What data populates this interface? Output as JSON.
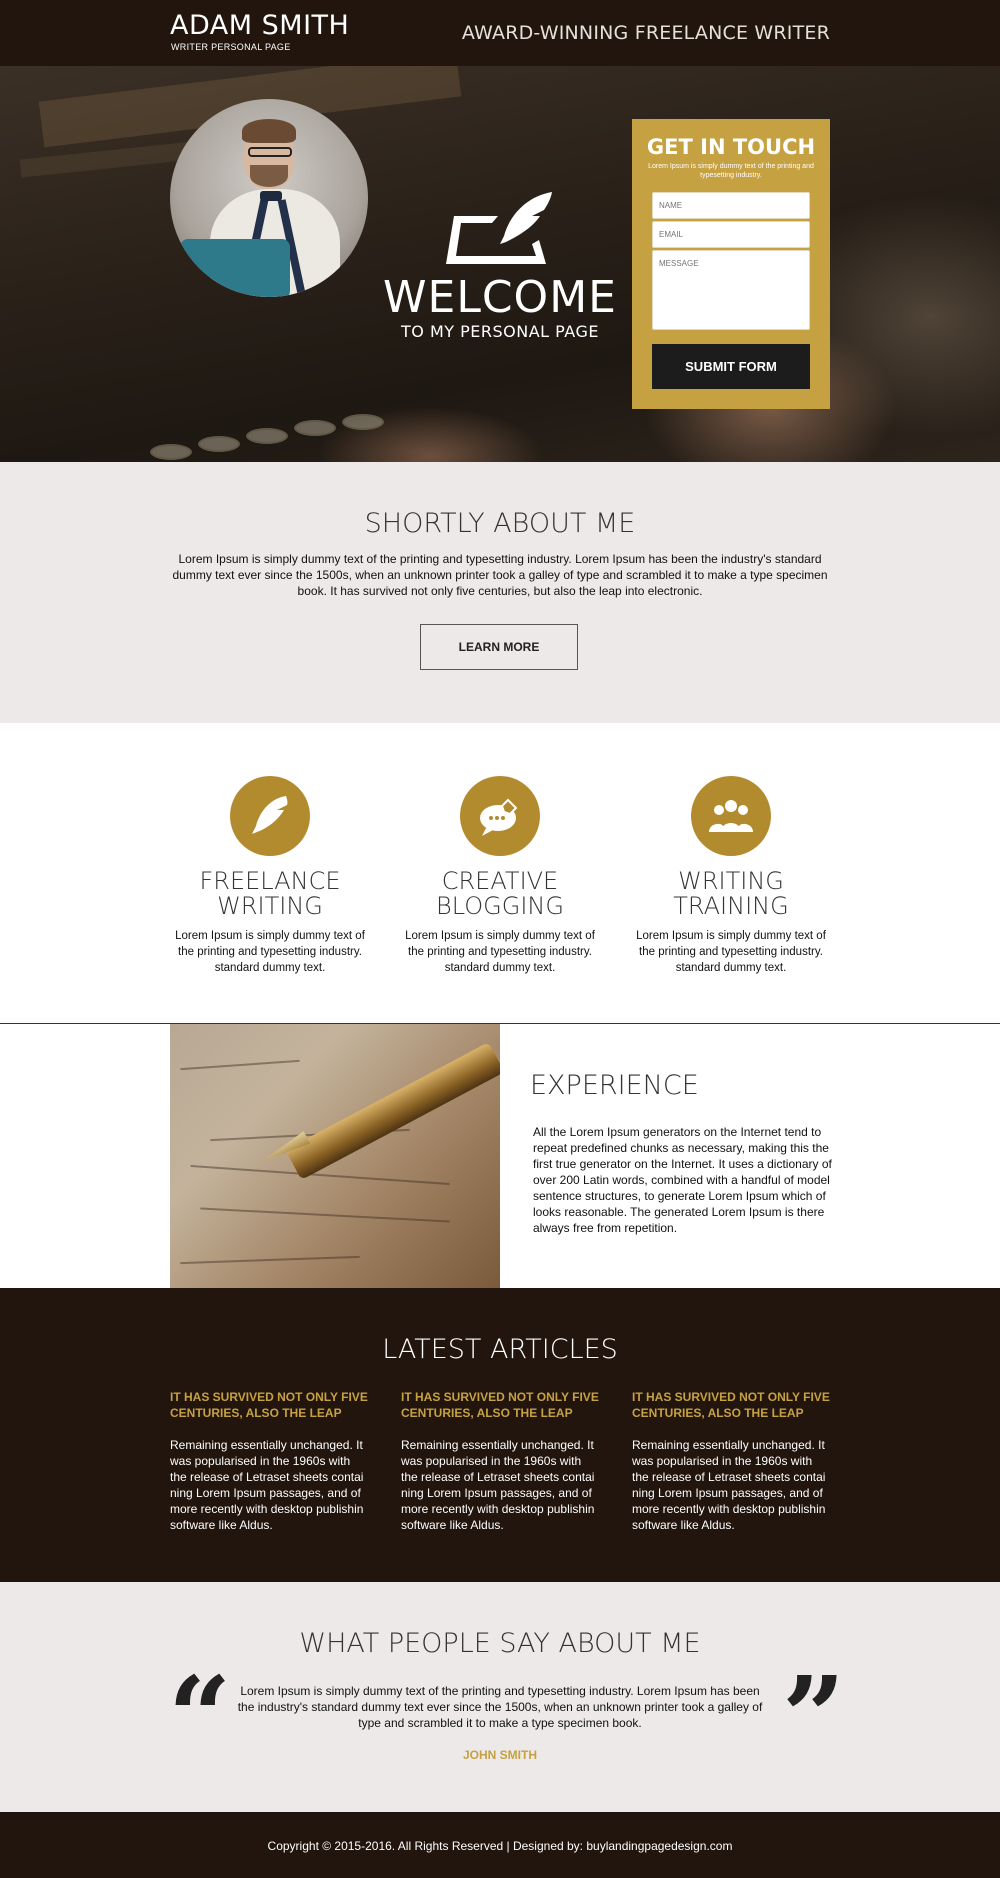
{
  "header": {
    "name": "ADAM SMITH",
    "subtitle": "WRITER PERSONAL PAGE",
    "tagline": "AWARD-WINNING FREELANCE WRITER"
  },
  "hero": {
    "welcome_title": "WELCOME",
    "welcome_subtitle": "TO MY PERSONAL PAGE"
  },
  "contact_form": {
    "title": "GET IN TOUCH",
    "description": "Lorem Ipsum is simply dummy text of the printing and typesetting industry.",
    "name_placeholder": "NAME",
    "email_placeholder": "EMAIL",
    "message_placeholder": "MESSAGE",
    "submit_label": "SUBMIT FORM"
  },
  "about": {
    "title": "SHORTLY ABOUT ME",
    "text": "Lorem Ipsum is simply dummy text of the printing and typesetting industry. Lorem Ipsum has been the industry's standard dummy text ever since the 1500s, when an unknown printer took a galley of type and scrambled it to make a type specimen book. It has survived not only five centuries, but also the leap into electronic.",
    "button_label": "LEARN MORE"
  },
  "services": [
    {
      "title": "FREELANCE WRITING",
      "icon": "feather-icon",
      "text": "Lorem Ipsum is simply dummy text of the printing and typesetting industry. standard dummy text."
    },
    {
      "title": "CREATIVE BLOGGING",
      "icon": "chat-bubble-icon",
      "text": "Lorem Ipsum is simply dummy text of the printing and typesetting industry. standard dummy text."
    },
    {
      "title": "WRITING TRAINING",
      "icon": "group-icon",
      "text": "Lorem Ipsum is simply dummy text of the printing and typesetting industry. standard dummy text."
    }
  ],
  "experience": {
    "title": "EXPERIENCE",
    "text": "All the Lorem Ipsum generators on the Internet tend to repeat predefined chunks as necessary, making this the first true generator on the Internet. It uses a dictionary of over 200 Latin words, combined with a handful of model sentence structures, to generate Lorem Ipsum which of looks reasonable. The generated Lorem Ipsum is there always free from repetition."
  },
  "articles": {
    "title": "LATEST ARTICLES",
    "items": [
      {
        "heading": "IT HAS SURVIVED NOT ONLY FIVE CENTURIES, ALSO THE LEAP",
        "body": "Remaining essentially unchanged. It was popularised in the 1960s with the release of Letraset sheets contai ning Lorem Ipsum passages, and of more recently with desktop publishin software like Aldus."
      },
      {
        "heading": "IT HAS SURVIVED NOT ONLY FIVE CENTURIES, ALSO THE LEAP",
        "body": "Remaining essentially unchanged. It was popularised in the 1960s with the release of Letraset sheets contai ning Lorem Ipsum passages, and of more recently with desktop publishin software like Aldus."
      },
      {
        "heading": "IT HAS SURVIVED NOT ONLY FIVE CENTURIES, ALSO THE LEAP",
        "body": "Remaining essentially unchanged. It was popularised in the 1960s with the release of Letraset sheets contai ning Lorem Ipsum passages, and of more recently with desktop publishin software like Aldus."
      }
    ]
  },
  "testimonials": {
    "title": "WHAT PEOPLE SAY ABOUT ME",
    "quote": "Lorem Ipsum is simply dummy text of the printing and typesetting industry. Lorem Ipsum has been the industry's standard dummy text ever since the 1500s, when an unknown printer took a galley of type and scrambled it to make a type specimen book.",
    "author": "JOHN SMITH",
    "open_quote": "“",
    "close_quote": "”"
  },
  "footer": {
    "text": "Copyright © 2015-2016. All Rights Reserved  |  Designed by: buylandingpagedesign.com"
  },
  "colors": {
    "dark_brown": "#22150e",
    "gold": "#c6a142",
    "icon_gold": "#b38b2f",
    "light_gray": "#ece9e8"
  }
}
